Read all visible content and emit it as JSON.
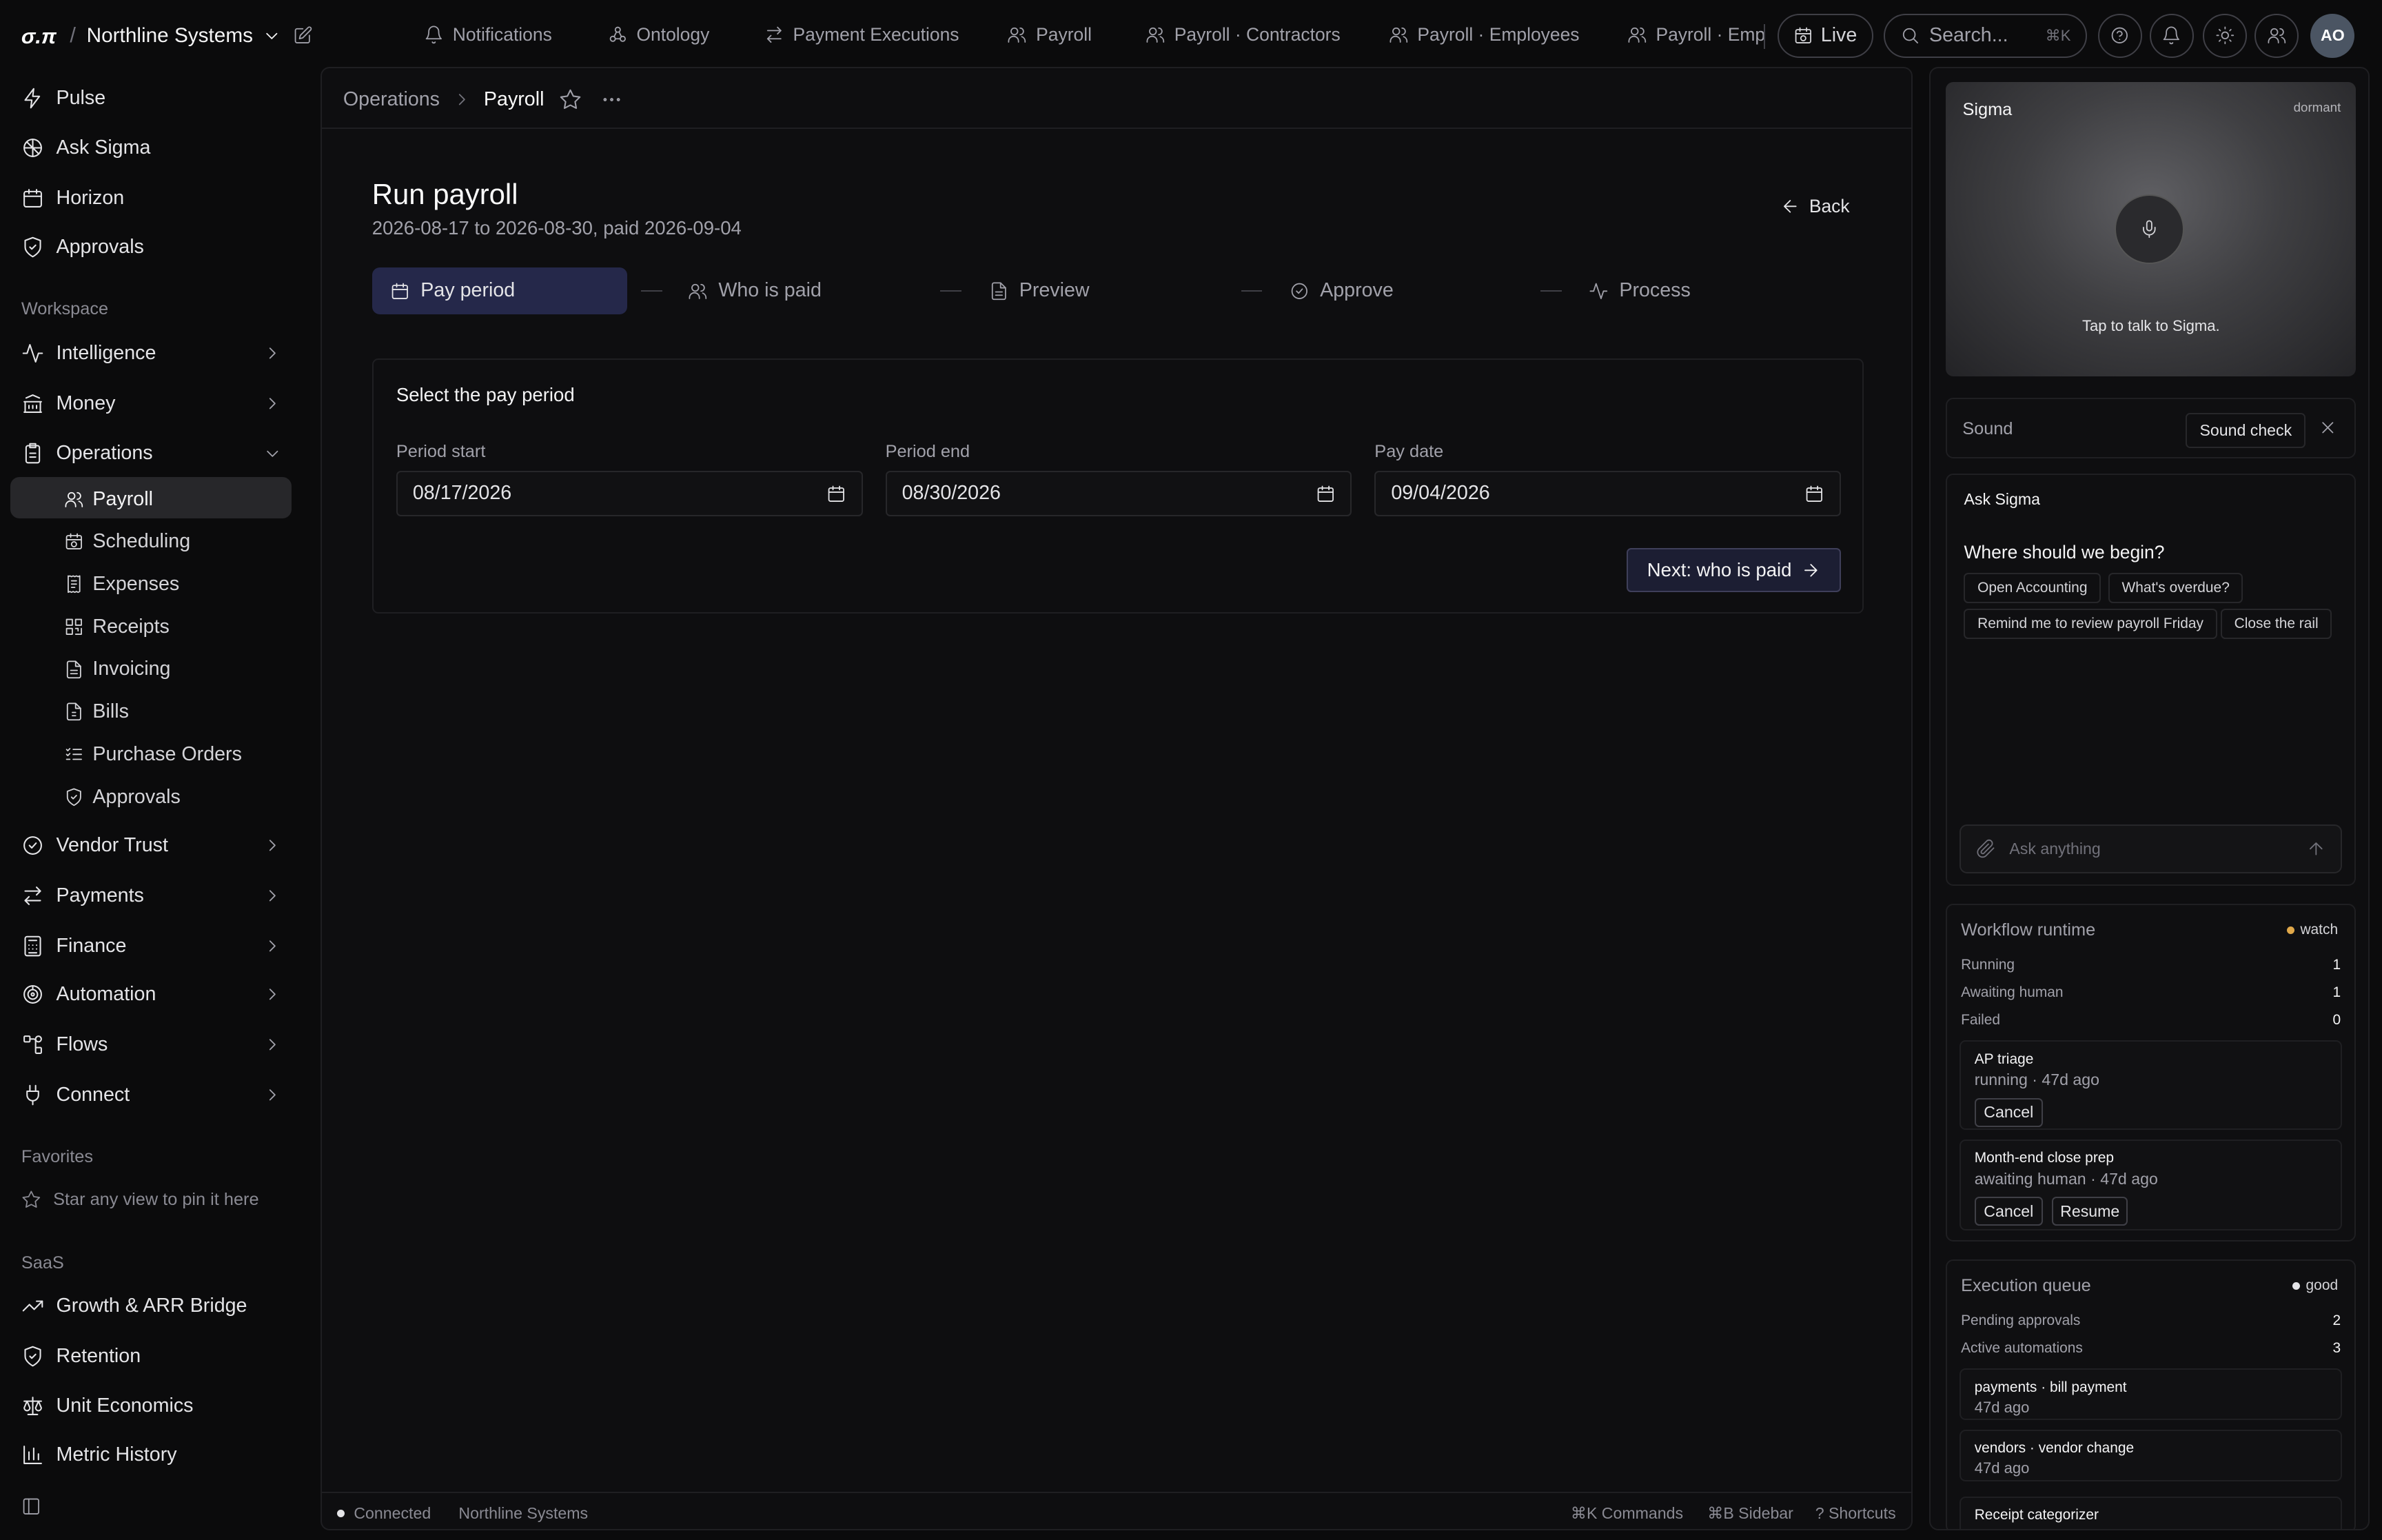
{
  "topbar": {
    "brand": "σ.π",
    "org_name": "Northline Systems",
    "nav": [
      {
        "label": "Notifications",
        "icon": "bell-icon"
      },
      {
        "label": "Ontology",
        "icon": "ontology-icon"
      },
      {
        "label": "Payment Executions",
        "icon": "arrows-icon"
      },
      {
        "label": "Payroll",
        "icon": "users-icon"
      },
      {
        "label": "Payroll · Contractors",
        "icon": "users-icon"
      },
      {
        "label": "Payroll · Employees",
        "icon": "users-icon"
      },
      {
        "label": "Payroll · Emp",
        "icon": "users-icon"
      }
    ],
    "live_label": "Live",
    "search_placeholder": "Search...",
    "search_shortcut": "⌘K",
    "avatar_initials": "AO"
  },
  "sidebar": {
    "top_items": [
      {
        "label": "Pulse",
        "icon": "bolt-icon"
      },
      {
        "label": "Ask Sigma",
        "icon": "sigma-icon"
      },
      {
        "label": "Horizon",
        "icon": "calendar-icon"
      },
      {
        "label": "Approvals",
        "icon": "shield-icon"
      }
    ],
    "workspace_label": "Workspace",
    "workspace_items": [
      {
        "label": "Intelligence",
        "icon": "activity-icon"
      },
      {
        "label": "Money",
        "icon": "bank-icon"
      },
      {
        "label": "Operations",
        "icon": "clipboard-icon"
      }
    ],
    "operations_children": [
      {
        "label": "Payroll",
        "icon": "users-icon"
      },
      {
        "label": "Scheduling",
        "icon": "calendar-clock-icon"
      },
      {
        "label": "Expenses",
        "icon": "receipt-icon"
      },
      {
        "label": "Receipts",
        "icon": "scan-icon"
      },
      {
        "label": "Invoicing",
        "icon": "file-icon"
      },
      {
        "label": "Bills",
        "icon": "file-text-icon"
      },
      {
        "label": "Purchase Orders",
        "icon": "list-check-icon"
      },
      {
        "label": "Approvals",
        "icon": "shield-icon"
      }
    ],
    "more_items": [
      {
        "label": "Vendor Trust",
        "icon": "check-circle-icon"
      },
      {
        "label": "Payments",
        "icon": "arrows-icon"
      },
      {
        "label": "Finance",
        "icon": "calculator-icon"
      },
      {
        "label": "Automation",
        "icon": "automation-icon"
      },
      {
        "label": "Flows",
        "icon": "flows-icon"
      },
      {
        "label": "Connect",
        "icon": "plug-icon"
      }
    ],
    "favorites_label": "Favorites",
    "favorites_empty": "Star any view to pin it here",
    "saas_label": "SaaS",
    "saas_items": [
      {
        "label": "Growth & ARR Bridge",
        "icon": "trend-icon"
      },
      {
        "label": "Retention",
        "icon": "shield-icon"
      },
      {
        "label": "Unit Economics",
        "icon": "scale-icon"
      },
      {
        "label": "Metric History",
        "icon": "bar-chart-icon"
      }
    ]
  },
  "main": {
    "breadcrumb": {
      "parent": "Operations",
      "current": "Payroll"
    },
    "title": "Run payroll",
    "subtitle": "2026-08-17 to 2026-08-30, paid 2026-09-04",
    "back_label": "Back",
    "steps": [
      {
        "label": "Pay period",
        "icon": "calendar-icon"
      },
      {
        "label": "Who is paid",
        "icon": "users-icon"
      },
      {
        "label": "Preview",
        "icon": "file-icon"
      },
      {
        "label": "Approve",
        "icon": "check-circle-icon"
      },
      {
        "label": "Process",
        "icon": "activity-icon"
      }
    ],
    "card": {
      "title": "Select the pay period",
      "fields": [
        {
          "label": "Period start",
          "value": "08/17/2026"
        },
        {
          "label": "Period end",
          "value": "08/30/2026"
        },
        {
          "label": "Pay date",
          "value": "09/04/2026"
        }
      ],
      "next_label": "Next: who is paid"
    },
    "statusbar": {
      "connection": "Connected",
      "org": "Northline Systems",
      "commands": "⌘K Commands",
      "sidebar": "⌘B Sidebar",
      "shortcuts": "? Shortcuts"
    }
  },
  "rail": {
    "sigma": {
      "name": "Sigma",
      "state": "dormant",
      "tap_text": "Tap to talk to Sigma."
    },
    "sound": {
      "label": "Sound",
      "check_label": "Sound check"
    },
    "ask": {
      "header": "Ask Sigma",
      "question": "Where should we begin?",
      "chips": [
        "Open Accounting",
        "What's overdue?",
        "Remind me to review payroll Friday",
        "Close the rail"
      ],
      "placeholder": "Ask anything"
    },
    "workflow": {
      "title": "Workflow runtime",
      "status": "watch",
      "status_color": "#e0a84a",
      "stats": [
        {
          "label": "Running",
          "value": "1"
        },
        {
          "label": "Awaiting human",
          "value": "1"
        },
        {
          "label": "Failed",
          "value": "0"
        }
      ],
      "items": [
        {
          "name": "AP triage",
          "status": "running · 47d ago",
          "actions": [
            "Cancel"
          ]
        },
        {
          "name": "Month-end close prep",
          "status": "awaiting human · 47d ago",
          "actions": [
            "Cancel",
            "Resume"
          ]
        }
      ]
    },
    "queue": {
      "title": "Execution queue",
      "status": "good",
      "status_color": "#e4e4e7",
      "stats": [
        {
          "label": "Pending approvals",
          "value": "2"
        },
        {
          "label": "Active automations",
          "value": "3"
        }
      ],
      "items": [
        {
          "name": "payments · bill payment",
          "status": "47d ago"
        },
        {
          "name": "vendors · vendor change",
          "status": "47d ago"
        },
        {
          "name": "Receipt categorizer",
          "status": ""
        }
      ]
    }
  }
}
